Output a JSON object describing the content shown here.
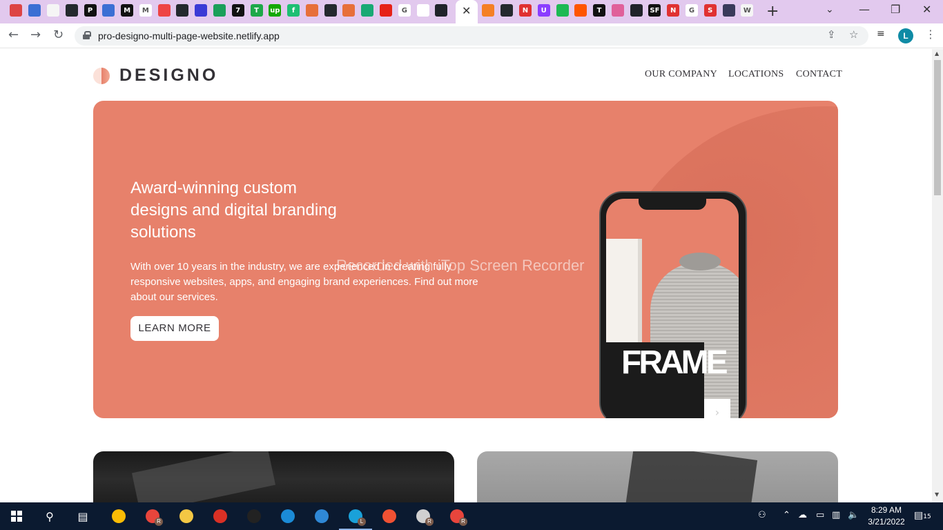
{
  "browser": {
    "url": "pro-designo-multi-page-website.netlify.app",
    "profile_initial": "L",
    "new_tab_label": "+",
    "active_tab_close": "✕",
    "tab_favicons_left": [
      {
        "name": "bookmark-icon",
        "color": "#d44",
        "glyph": ""
      },
      {
        "name": "ms-icon",
        "color": "#3b6fd4",
        "glyph": ""
      },
      {
        "name": "page-icon",
        "color": "#f5f5f5",
        "glyph": ""
      },
      {
        "name": "github-icon",
        "color": "#24292e",
        "glyph": ""
      },
      {
        "name": "p-icon",
        "color": "#111",
        "glyph": "P"
      },
      {
        "name": "ms-icon",
        "color": "#3b6fd4",
        "glyph": ""
      },
      {
        "name": "medium-icon",
        "color": "#111",
        "glyph": "M"
      },
      {
        "name": "gmail-icon",
        "color": "#fff",
        "glyph": "M"
      },
      {
        "name": "smile-icon",
        "color": "#e44",
        "glyph": ""
      },
      {
        "name": "github-icon",
        "color": "#24292e",
        "glyph": ""
      },
      {
        "name": "moon-icon",
        "color": "#3a3ad6",
        "glyph": ""
      },
      {
        "name": "phone-icon",
        "color": "#1a9f5a",
        "glyph": ""
      },
      {
        "name": "seven-icon",
        "color": "#111",
        "glyph": "7"
      },
      {
        "name": "t-icon",
        "color": "#1da849",
        "glyph": "T"
      },
      {
        "name": "upwork-icon",
        "color": "#14a800",
        "glyph": "up"
      },
      {
        "name": "fiverr-icon",
        "color": "#1dbf73",
        "glyph": "f"
      },
      {
        "name": "shield-icon",
        "color": "#e76f3a",
        "glyph": ""
      },
      {
        "name": "github-icon",
        "color": "#24292e",
        "glyph": ""
      },
      {
        "name": "shield-icon",
        "color": "#e76f3a",
        "glyph": ""
      },
      {
        "name": "diamond-icon",
        "color": "#19a974",
        "glyph": ""
      },
      {
        "name": "youtube-icon",
        "color": "#e62117",
        "glyph": ""
      },
      {
        "name": "google-icon",
        "color": "#fff",
        "glyph": "G"
      },
      {
        "name": "dnd-icon",
        "color": "#fff",
        "glyph": ""
      },
      {
        "name": "react-icon",
        "color": "#20232a",
        "glyph": ""
      }
    ],
    "tab_favicons_right": [
      {
        "name": "stackoverflow-icon",
        "color": "#f48024",
        "glyph": ""
      },
      {
        "name": "github-icon",
        "color": "#24292e",
        "glyph": ""
      },
      {
        "name": "n-icon",
        "color": "#e03131",
        "glyph": "N"
      },
      {
        "name": "u-icon",
        "color": "#8b3dff",
        "glyph": "U"
      },
      {
        "name": "spotify-icon",
        "color": "#1db954",
        "glyph": ""
      },
      {
        "name": "soundcloud-icon",
        "color": "#ff5500",
        "glyph": ""
      },
      {
        "name": "t-icon",
        "color": "#111",
        "glyph": "T"
      },
      {
        "name": "brush-icon",
        "color": "#e0609a",
        "glyph": ""
      },
      {
        "name": "react-icon",
        "color": "#20232a",
        "glyph": ""
      },
      {
        "name": "sf-icon",
        "color": "#111",
        "glyph": "SF"
      },
      {
        "name": "n-icon",
        "color": "#e03131",
        "glyph": "N"
      },
      {
        "name": "google-icon",
        "color": "#fff",
        "glyph": "G"
      },
      {
        "name": "s-icon",
        "color": "#e03131",
        "glyph": "S"
      },
      {
        "name": "dark-icon",
        "color": "#3a3a5a",
        "glyph": ""
      },
      {
        "name": "wordpress-icon",
        "color": "#f5f5f5",
        "glyph": "W"
      }
    ]
  },
  "site": {
    "logo_text": "DESIGNO",
    "nav": [
      "OUR COMPANY",
      "LOCATIONS",
      "CONTACT"
    ],
    "hero": {
      "title": "Award-winning custom designs and digital branding solutions",
      "description": "With over 10 years in the industry, we are experienced in creating fully responsive websites, apps, and engaging brand experiences. Find out more about our services.",
      "button": "LEARN MORE"
    },
    "phone_screen_text": "FRAME",
    "watermark": "Recorded with iTop Screen Recorder"
  },
  "colors": {
    "peach": "#e7816b",
    "dark_grey": "#333136",
    "tabstrip": "#e2c9ee",
    "taskbar": "#0b1a30"
  },
  "taskbar": {
    "time": "8:29 AM",
    "date": "3/21/2022",
    "notification_count": "15",
    "apps": [
      {
        "name": "chrome-icon",
        "badge": ""
      },
      {
        "name": "chrome-profile-icon",
        "badge": "R"
      },
      {
        "name": "file-explorer-icon",
        "badge": ""
      },
      {
        "name": "recorder-icon",
        "badge": ""
      },
      {
        "name": "terminal-icon",
        "badge": ""
      },
      {
        "name": "edge-icon",
        "badge": ""
      },
      {
        "name": "vscode-icon",
        "badge": ""
      },
      {
        "name": "chrome-profile-icon",
        "badge": "L"
      },
      {
        "name": "git-icon",
        "badge": ""
      },
      {
        "name": "remote-icon",
        "badge": "R"
      },
      {
        "name": "chrome-profile-icon",
        "badge": "R"
      }
    ]
  }
}
